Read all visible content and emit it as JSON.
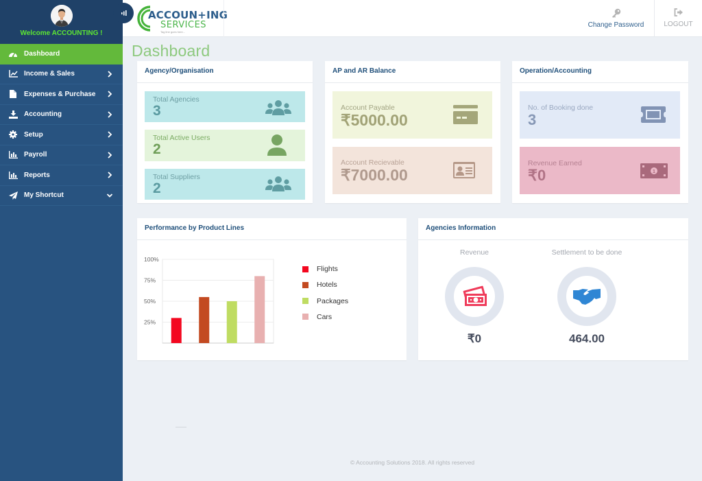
{
  "sidebar": {
    "welcome": "Welcome ACCOUNTING !",
    "items": [
      {
        "label": "Dashboard",
        "icon": "dashboard-icon",
        "active": true
      },
      {
        "label": "Income & Sales",
        "icon": "line-chart-icon"
      },
      {
        "label": "Expenses & Purchase",
        "icon": "file-icon"
      },
      {
        "label": "Accounting",
        "icon": "download-icon"
      },
      {
        "label": "Setup",
        "icon": "gear-icon"
      },
      {
        "label": "Payroll",
        "icon": "bar-chart-icon"
      },
      {
        "label": "Reports",
        "icon": "bar-chart-icon"
      },
      {
        "label": "My Shortcut",
        "icon": "paper-plane-icon",
        "expanded": true
      }
    ]
  },
  "header": {
    "logo_line1": "ACCOUN+ING",
    "logo_line2": "SERVICES",
    "logo_tagline": "Tag line goes here...",
    "change_password": "Change Password",
    "logout": "LOGOUT"
  },
  "page": {
    "title": "Dashboard"
  },
  "agency": {
    "title": "Agency/Organisation",
    "tiles": [
      {
        "label": "Total Agencies",
        "value": "3"
      },
      {
        "label": "Total Active Users",
        "value": "2"
      },
      {
        "label": "Total Suppliers",
        "value": "2"
      }
    ]
  },
  "apar": {
    "title": "AP and AR Balance",
    "tiles": [
      {
        "label": "Account Payable",
        "value": "₹5000.00"
      },
      {
        "label": "Account Recievable",
        "value": "₹7000.00"
      }
    ]
  },
  "operation": {
    "title": "Operation/Accounting",
    "tiles": [
      {
        "label": "No. of Booking done",
        "value": "3"
      },
      {
        "label": "Revenue Earned",
        "value": "₹0"
      }
    ]
  },
  "performance": {
    "title": "Performance by Product Lines"
  },
  "chart_data": {
    "type": "bar",
    "title": "Performance by Product Lines",
    "categories": [
      "Flights",
      "Hotels",
      "Packages",
      "Cars"
    ],
    "values": [
      30,
      55,
      50,
      80
    ],
    "colors": [
      "#f3071f",
      "#c34a21",
      "#bfdc62",
      "#e8b0b0"
    ],
    "ylim": [
      0,
      100
    ],
    "yticks": [
      "25%",
      "50%",
      "75%",
      "100%"
    ],
    "ytick_values": [
      25,
      50,
      75,
      100
    ],
    "xlabel": "",
    "ylabel": "",
    "grid": true,
    "legend": "right"
  },
  "agencies_info": {
    "title": "Agencies Information",
    "revenue_label": "Revenue",
    "revenue_value": "₹0",
    "settlement_label": "Settlement to be done",
    "settlement_value": "464.00"
  },
  "footer": {
    "text": "© Accounting Solutions 2018. All rights reserved"
  }
}
